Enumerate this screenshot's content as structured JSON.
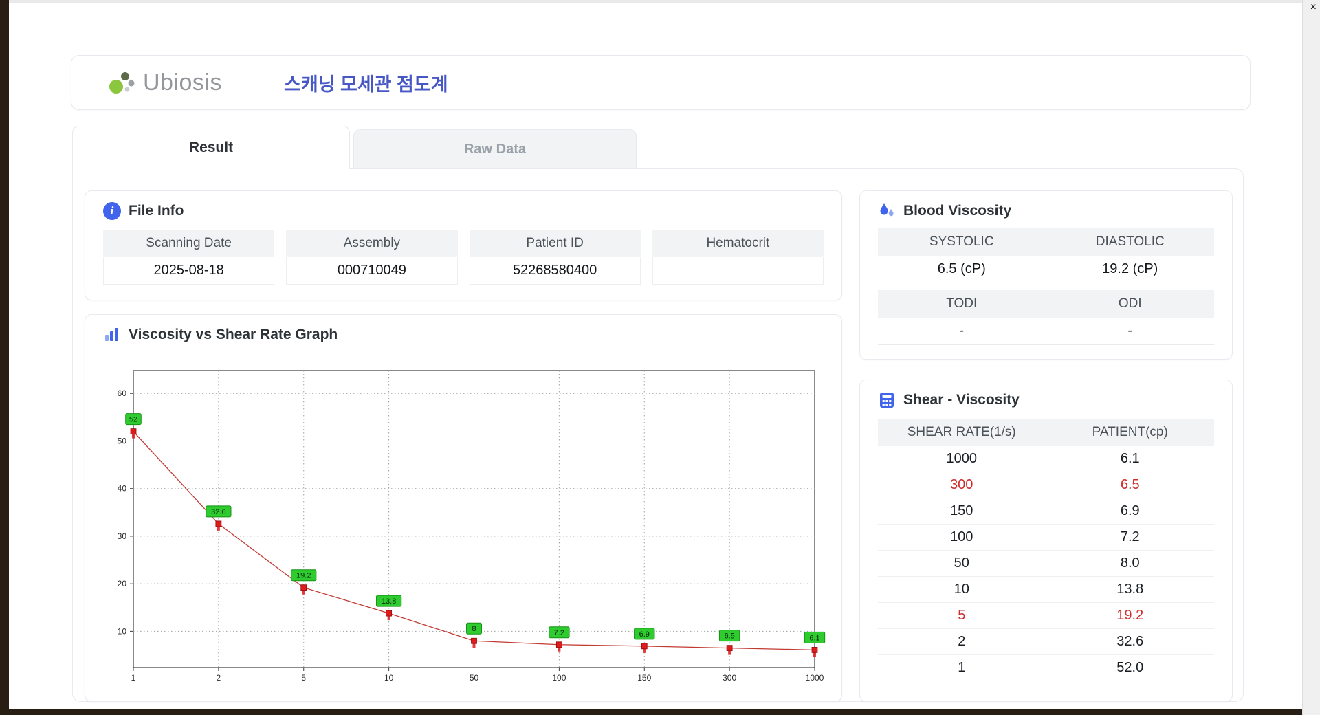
{
  "window": {
    "close_label": "×"
  },
  "header": {
    "brand": "Ubiosis",
    "title_korean": "스캐닝 모세관 점도계"
  },
  "tabs": [
    {
      "label": "Result",
      "active": true
    },
    {
      "label": "Raw Data",
      "active": false
    }
  ],
  "file_info": {
    "section_title": "File Info",
    "fields": [
      {
        "label": "Scanning Date",
        "value": "2025-08-18"
      },
      {
        "label": "Assembly",
        "value": "000710049"
      },
      {
        "label": "Patient ID",
        "value": "52268580400"
      },
      {
        "label": "Hematocrit",
        "value": ""
      }
    ]
  },
  "blood_viscosity": {
    "section_title": "Blood Viscosity",
    "row1": {
      "label1": "SYSTOLIC",
      "label2": "DIASTOLIC",
      "value1": "6.5 (cP)",
      "value2": "19.2 (cP)"
    },
    "row2": {
      "label1": "TODI",
      "label2": "ODI",
      "value1": "-",
      "value2": "-"
    }
  },
  "graph": {
    "section_title": "Viscosity vs Shear Rate Graph"
  },
  "shear_table": {
    "section_title": "Shear - Viscosity",
    "columns": [
      "SHEAR RATE(1/s)",
      "PATIENT(cp)"
    ],
    "rows": [
      {
        "shear": "1000",
        "patient": "6.1",
        "highlight": false
      },
      {
        "shear": "300",
        "patient": "6.5",
        "highlight": true
      },
      {
        "shear": "150",
        "patient": "6.9",
        "highlight": false
      },
      {
        "shear": "100",
        "patient": "7.2",
        "highlight": false
      },
      {
        "shear": "50",
        "patient": "8.0",
        "highlight": false
      },
      {
        "shear": "10",
        "patient": "13.8",
        "highlight": false
      },
      {
        "shear": "5",
        "patient": "19.2",
        "highlight": true
      },
      {
        "shear": "2",
        "patient": "32.6",
        "highlight": false
      },
      {
        "shear": "1",
        "patient": "52.0",
        "highlight": false
      }
    ]
  },
  "chart_data": {
    "type": "line",
    "title": "Viscosity vs Shear Rate Graph",
    "categories": [
      "1",
      "2",
      "5",
      "10",
      "50",
      "100",
      "150",
      "300",
      "1000"
    ],
    "values": [
      52,
      32.6,
      19.2,
      13.8,
      8,
      7.2,
      6.9,
      6.5,
      6.1
    ],
    "point_labels": [
      "52",
      "32.6",
      "19.2",
      "13.8",
      "8",
      "7.2",
      "6.9",
      "6.5",
      "6.1"
    ],
    "xlabel": "",
    "ylabel": "",
    "x_axis_type": "categorical-even-spacing",
    "y_ticks": [
      10,
      20,
      30,
      40,
      50,
      60
    ],
    "ylim": [
      2.4,
      64.8
    ],
    "grid": true,
    "grid_style": "dotted",
    "legend": "none",
    "line_color": "#c23b33",
    "marker_color": "#e01b1b",
    "marker_shape": "square",
    "label_bg": "#2fcc2f",
    "label_border": "#169216"
  },
  "colors": {
    "accent_blue": "#4263eb",
    "title_blue": "#4758c5",
    "header_gray": "#f1f3f5",
    "highlight_red": "#cf2d2d",
    "logo_green": "#8cc63f"
  }
}
